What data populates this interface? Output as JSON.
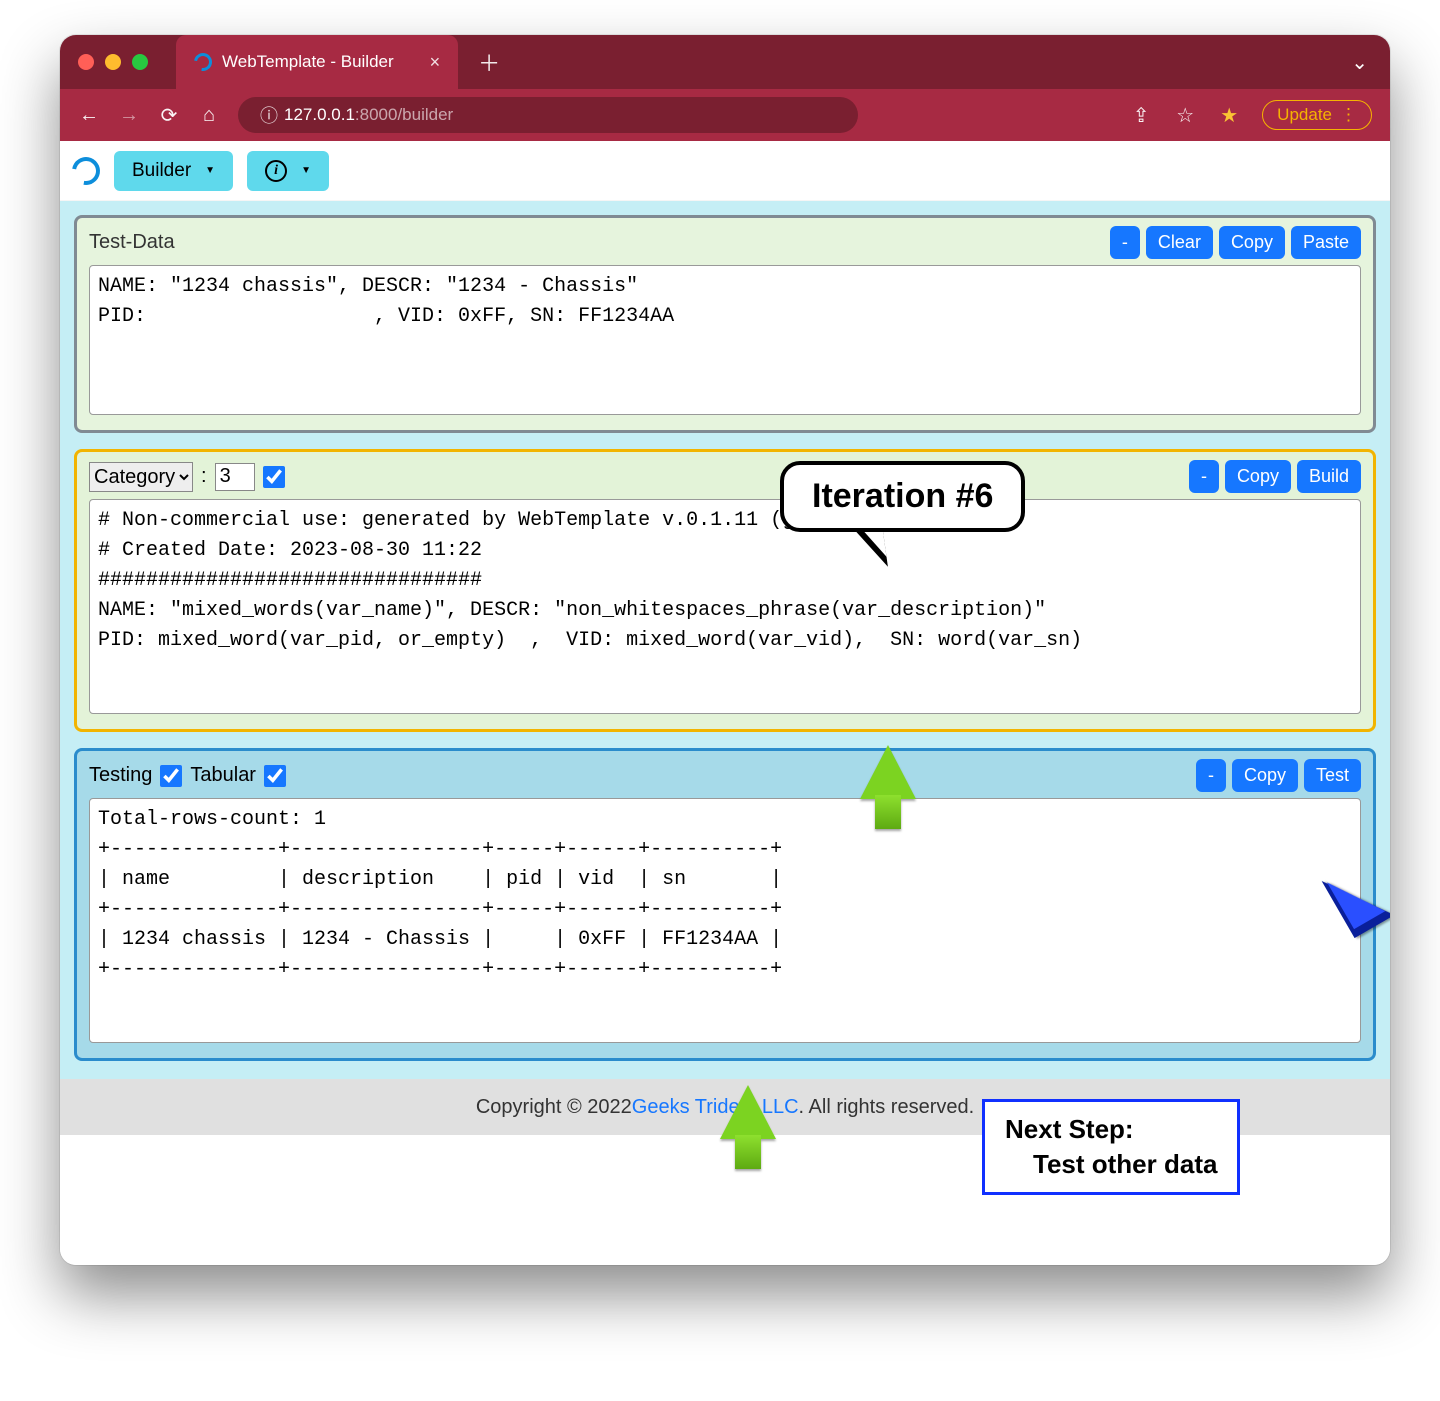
{
  "browser": {
    "tab_title": "WebTemplate - Builder",
    "url_display_prefix": "127.0.0.1",
    "url_display_suffix": ":8000/builder",
    "update_label": "Update"
  },
  "toolbar": {
    "builder_label": "Builder"
  },
  "panel_testdata": {
    "title": "Test-Data",
    "buttons": {
      "min": "-",
      "clear": "Clear",
      "copy": "Copy",
      "paste": "Paste"
    },
    "text": "NAME: \"1234 chassis\", DESCR: \"1234 - Chassis\"\nPID:                   , VID: 0xFF, SN: FF1234AA"
  },
  "panel_template": {
    "category_label": "Category",
    "sep": ":",
    "number": "3",
    "buttons": {
      "min": "-",
      "copy": "Copy",
      "build": "Build"
    },
    "text": "# Non-commercial use: generated by WebTemplate v.0.1.11 (geekstrident.com)\n# Created Date: 2023-08-30 11:22\n################################\nNAME: \"mixed_words(var_name)\", DESCR: \"non_whitespaces_phrase(var_description)\"\nPID: mixed_word(var_pid, or_empty)  ,  VID: mixed_word(var_vid),  SN: word(var_sn)"
  },
  "panel_testing": {
    "title": "Testing",
    "tabular_label": "Tabular",
    "buttons": {
      "min": "-",
      "copy": "Copy",
      "test": "Test"
    },
    "text": "Total-rows-count: 1\n+--------------+----------------+-----+------+----------+\n| name         | description    | pid | vid  | sn       |\n+--------------+----------------+-----+------+----------+\n| 1234 chassis | 1234 - Chassis |     | 0xFF | FF1234AA |\n+--------------+----------------+-----+------+----------+"
  },
  "overlays": {
    "iteration": "Iteration #6",
    "next_step_title": "Next Step:",
    "next_step_body": "Test other data"
  },
  "footer": {
    "prefix": "Copyright © 2022 ",
    "link": "Geeks Trident LLC",
    "suffix": ". All rights reserved."
  },
  "chart_data": {
    "type": "table",
    "title": "Total-rows-count: 1",
    "columns": [
      "name",
      "description",
      "pid",
      "vid",
      "sn"
    ],
    "rows": [
      {
        "name": "1234 chassis",
        "description": "1234 - Chassis",
        "pid": "",
        "vid": "0xFF",
        "sn": "FF1234AA"
      }
    ]
  }
}
